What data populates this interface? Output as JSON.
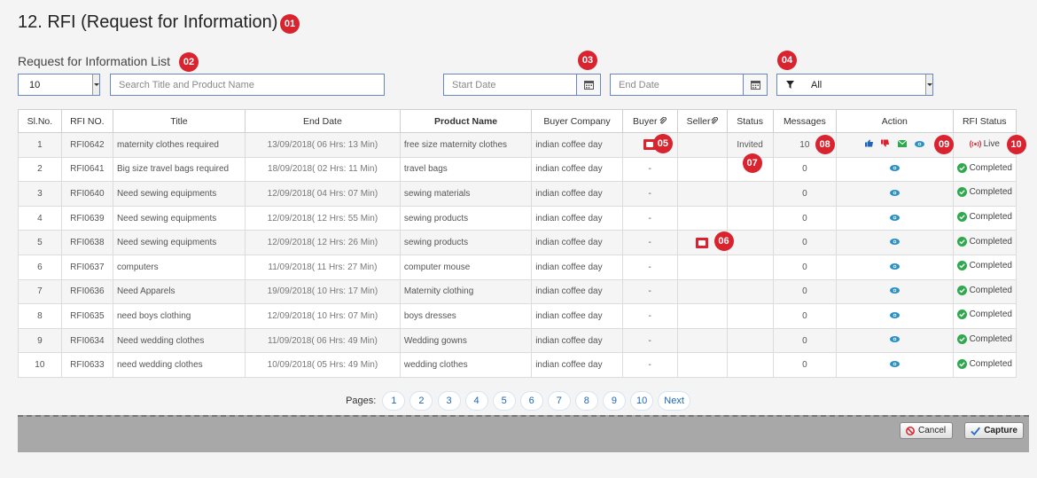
{
  "page_title": "12. RFI (Request for Information)",
  "section_title": "Request for Information List",
  "badges": [
    "01",
    "02",
    "03",
    "04",
    "05",
    "06",
    "07",
    "08",
    "09",
    "10"
  ],
  "controls": {
    "page_size": "10",
    "search_placeholder": "Search Title and Product Name",
    "start_date_placeholder": "Start Date",
    "end_date_placeholder": "End Date",
    "filter_value": "All"
  },
  "table": {
    "headers": [
      "Sl.No.",
      "RFI NO.",
      "Title",
      "End Date",
      "Product Name",
      "Buyer Company",
      "Buyer",
      "Seller",
      "Status",
      "Messages",
      "Action",
      "RFI Status"
    ],
    "rows": [
      {
        "sl": "1",
        "rfi": "RFI0642",
        "title": "maternity clothes required",
        "end": "13/09/2018( 06 Hrs: 13 Min)",
        "product": "free size maternity clothes",
        "company": "indian coffee day",
        "buyer": "",
        "seller": "",
        "status": "Invited",
        "messages": "10",
        "rfi_status": "Live"
      },
      {
        "sl": "2",
        "rfi": "RFI0641",
        "title": "Big size travel bags required",
        "end": "18/09/2018( 02 Hrs: 11 Min)",
        "product": "travel bags",
        "company": "indian coffee day",
        "buyer": "-",
        "seller": "",
        "status": "",
        "messages": "0",
        "rfi_status": "Completed"
      },
      {
        "sl": "3",
        "rfi": "RFI0640",
        "title": "Need sewing equipments",
        "end": "12/09/2018( 04 Hrs: 07 Min)",
        "product": "sewing materials",
        "company": "indian coffee day",
        "buyer": "-",
        "seller": "",
        "status": "",
        "messages": "0",
        "rfi_status": "Completed"
      },
      {
        "sl": "4",
        "rfi": "RFI0639",
        "title": "Need sewing equipments",
        "end": "12/09/2018( 12 Hrs: 55 Min)",
        "product": "sewing products",
        "company": "indian coffee day",
        "buyer": "-",
        "seller": "",
        "status": "",
        "messages": "0",
        "rfi_status": "Completed"
      },
      {
        "sl": "5",
        "rfi": "RFI0638",
        "title": "Need sewing equipments",
        "end": "12/09/2018( 12 Hrs: 26 Min)",
        "product": "sewing products",
        "company": "indian coffee day",
        "buyer": "-",
        "seller": "",
        "status": "",
        "messages": "0",
        "rfi_status": "Completed"
      },
      {
        "sl": "6",
        "rfi": "RFI0637",
        "title": "computers",
        "end": "11/09/2018( 11 Hrs: 27 Min)",
        "product": "computer mouse",
        "company": "indian coffee day",
        "buyer": "-",
        "seller": "",
        "status": "",
        "messages": "0",
        "rfi_status": "Completed"
      },
      {
        "sl": "7",
        "rfi": "RFI0636",
        "title": "Need Apparels",
        "end": "19/09/2018( 10 Hrs: 17 Min)",
        "product": "Maternity clothing",
        "company": "indian coffee day",
        "buyer": "-",
        "seller": "",
        "status": "",
        "messages": "0",
        "rfi_status": "Completed"
      },
      {
        "sl": "8",
        "rfi": "RFI0635",
        "title": "need boys clothing",
        "end": "12/09/2018( 10 Hrs: 07 Min)",
        "product": "boys dresses",
        "company": "indian coffee day",
        "buyer": "-",
        "seller": "",
        "status": "",
        "messages": "0",
        "rfi_status": "Completed"
      },
      {
        "sl": "9",
        "rfi": "RFI0634",
        "title": "Need wedding clothes",
        "end": "11/09/2018( 06 Hrs: 49 Min)",
        "product": "Wedding gowns",
        "company": "indian coffee day",
        "buyer": "-",
        "seller": "",
        "status": "",
        "messages": "0",
        "rfi_status": "Completed"
      },
      {
        "sl": "10",
        "rfi": "RFI0633",
        "title": "need wedding clothes",
        "end": "10/09/2018( 05 Hrs: 49 Min)",
        "product": "wedding clothes",
        "company": "indian coffee day",
        "buyer": "-",
        "seller": "",
        "status": "",
        "messages": "0",
        "rfi_status": "Completed"
      }
    ]
  },
  "pager": {
    "label": "Pages:",
    "pages": [
      "1",
      "2",
      "3",
      "4",
      "5",
      "6",
      "7",
      "8",
      "9",
      "10"
    ],
    "next": "Next"
  },
  "footer": {
    "cancel": "Cancel",
    "capture": "Capture"
  },
  "colors": {
    "badge": "#d9232f",
    "link_blue": "#1e66b5",
    "completed_green": "#2fa84f",
    "live_red": "#d9232f"
  }
}
